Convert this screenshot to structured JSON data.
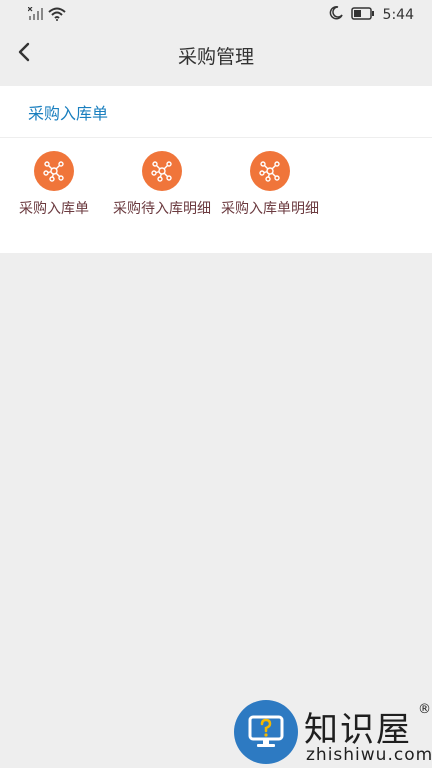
{
  "status_bar": {
    "time": "5:44",
    "icons": [
      "signal-icon",
      "wifi-icon",
      "moon-icon",
      "battery-icon"
    ]
  },
  "header": {
    "title": "采购管理",
    "back_icon": "back-arrow-icon"
  },
  "section": {
    "title": "采购入库单",
    "items": [
      {
        "label": "采购入库单",
        "icon": "network-icon"
      },
      {
        "label": "采购待入库明细",
        "icon": "network-icon"
      },
      {
        "label": "采购入库单明细",
        "icon": "network-icon"
      }
    ]
  },
  "watermark": {
    "name": "知识屋",
    "registered": "®",
    "url": "zhishiwu.com"
  },
  "colors": {
    "accent_blue": "#1a7fbf",
    "icon_orange": "#f0753a",
    "label_text": "#6b3a3f",
    "background": "#eeeeee",
    "watermark_blue": "#2d7ac2"
  }
}
